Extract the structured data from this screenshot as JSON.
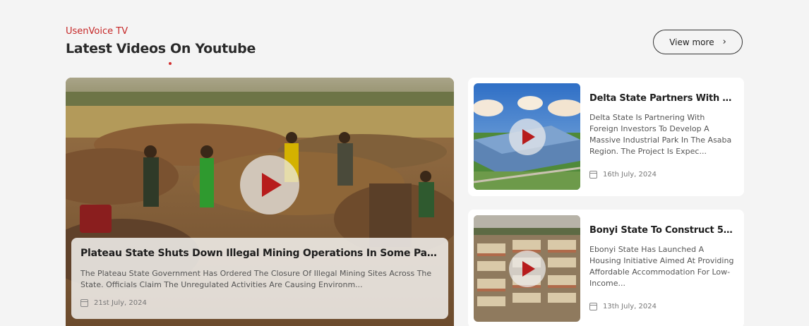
{
  "section": {
    "eyebrow": "UsenVoice TV",
    "title": "Latest Videos On Youtube",
    "view_more_label": "View more"
  },
  "featured": {
    "title": "Plateau State Shuts Down Illegal Mining Operations In Some Parts...",
    "description": "The Plateau State Government Has Ordered The Closure Of Illegal Mining Sites Across The State. Officials Claim The Unregulated Activities Are Causing Environm...",
    "date": "21st July, 2024",
    "image": "mining-site-photo"
  },
  "videos": [
    {
      "title": "Delta State Partners With Fore...",
      "description": "Delta State Is Partnering With Foreign Investors To Develop A Massive Industrial Park In The Asaba Region. The Project Is Expec...",
      "date": "16th July, 2024",
      "image": "industrial-park-photo"
    },
    {
      "title": "Bonyi State To Construct 500...",
      "description": "Ebonyi State Has Launched A Housing Initiative Aimed At Providing Affordable Accommodation For Low-Income...",
      "date": "13th July, 2024",
      "image": "housing-estate-photo"
    }
  ],
  "colors": {
    "accent": "#c62828",
    "background": "#f4f4f4",
    "play_icon": "#b71c1c"
  },
  "icons": {
    "play": "play-icon",
    "calendar": "calendar-icon",
    "chevron": "chevron-right-icon"
  }
}
